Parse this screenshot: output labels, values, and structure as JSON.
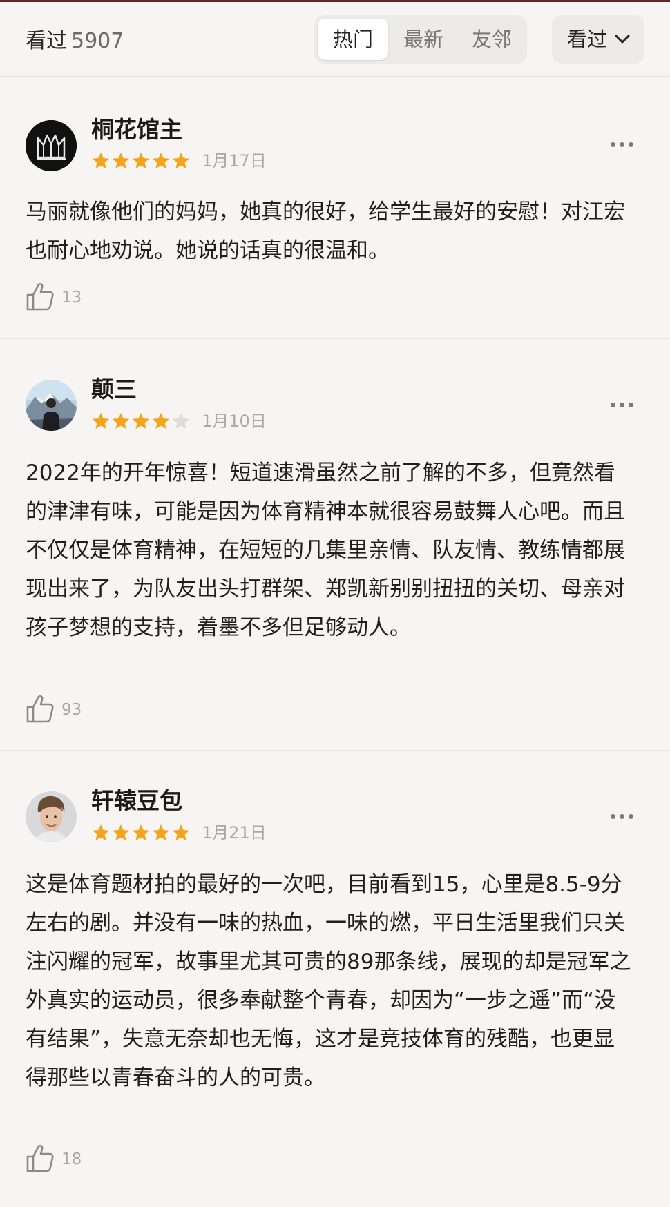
{
  "header": {
    "watched_label": "看过",
    "watched_count": "5907",
    "tabs": [
      {
        "label": "热门",
        "active": true
      },
      {
        "label": "最新",
        "active": false
      },
      {
        "label": "友邻",
        "active": false
      }
    ],
    "filter_label": "看过",
    "filter_icon": "chevron-down-icon"
  },
  "colors": {
    "star_filled": "#f5a31a",
    "star_empty": "#dcdcdc",
    "top_bar": "#5a2b25",
    "background": "#f7f5f3"
  },
  "reviews": [
    {
      "user": "桐花馆主",
      "rating": 5,
      "date": "1月17日",
      "text": "马丽就像他们的妈妈，她真的很好，给学生最好的安慰！对江宏也耐心地劝说。她说的话真的很温和。",
      "likes": "13",
      "avatar_icon": "crown-logo-avatar"
    },
    {
      "user": "颠三",
      "rating": 4,
      "date": "1月10日",
      "text": "2022年的开年惊喜！短道速滑虽然之前了解的不多，但竟然看的津津有味，可能是因为体育精神本就很容易鼓舞人心吧。而且不仅仅是体育精神，在短短的几集里亲情、队友情、教练情都展现出来了，为队友出头打群架、郑凯新别别扭扭的关切、母亲对孩子梦想的支持，着墨不多但足够动人。",
      "likes": "93",
      "avatar_icon": "mountain-photo-avatar"
    },
    {
      "user": "轩辕豆包",
      "rating": 5,
      "date": "1月21日",
      "text": "这是体育题材拍的最好的一次吧，目前看到15，心里是8.5-9分左右的剧。并没有一味的热血，一味的燃，平日生活里我们只关注闪耀的冠军，故事里尤其可贵的89那条线，展现的却是冠军之外真实的运动员，很多奉献整个青春，却因为“一步之遥”而“没有结果”，失意无奈却也无悔，这才是竞技体育的残酷，也更显得那些以青春奋斗的人的可贵。",
      "likes": "18",
      "avatar_icon": "portrait-photo-avatar"
    }
  ]
}
